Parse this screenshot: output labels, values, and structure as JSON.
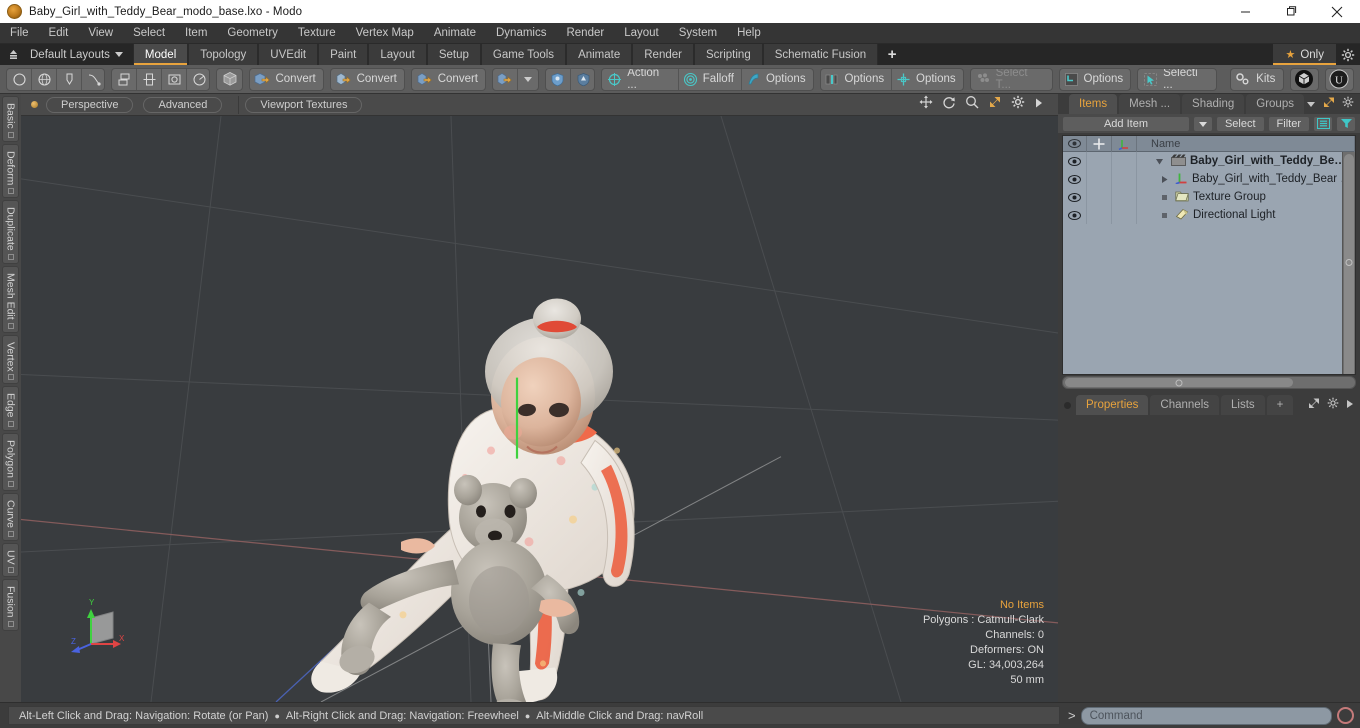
{
  "window": {
    "title": "Baby_Girl_with_Teddy_Bear_modo_base.lxo - Modo",
    "app_icon": "modo-app-icon",
    "minimize": "minimize-icon",
    "maximize": "restore-icon",
    "close": "close-icon"
  },
  "menubar": {
    "items": [
      "File",
      "Edit",
      "View",
      "Select",
      "Item",
      "Geometry",
      "Texture",
      "Vertex Map",
      "Animate",
      "Dynamics",
      "Render",
      "Layout",
      "System",
      "Help"
    ]
  },
  "layoutbar": {
    "home_icon": "home-layout-icon",
    "dropdown_label": "Default Layouts",
    "tabs": [
      "Model",
      "Topology",
      "UVEdit",
      "Paint",
      "Layout",
      "Setup",
      "Game Tools",
      "Animate",
      "Render",
      "Scripting",
      "Schematic Fusion"
    ],
    "active_tab": "Model",
    "add_tab": "+",
    "only_label": "Only",
    "only_star": "star-icon",
    "gear": "gear-icon"
  },
  "toolbar": {
    "groups": [
      {
        "items": [
          {
            "name": "circle-primitive-icon",
            "label": ""
          },
          {
            "name": "sphere-primitive-icon",
            "label": ""
          },
          {
            "name": "pen-tool-icon",
            "label": ""
          },
          {
            "name": "curve-tool-icon",
            "label": ""
          }
        ]
      },
      {
        "items": [
          {
            "name": "array-icon",
            "label": ""
          },
          {
            "name": "mirror-icon",
            "label": ""
          },
          {
            "name": "bevel-icon",
            "label": ""
          },
          {
            "name": "radial-icon",
            "label": ""
          }
        ]
      },
      {
        "items": [
          {
            "name": "cube-icon",
            "label": ""
          }
        ]
      },
      {
        "items": [
          {
            "name": "convert-mesh-icon",
            "label": "Convert"
          }
        ]
      },
      {
        "items": [
          {
            "name": "convert-curve-icon",
            "label": "Convert"
          }
        ]
      },
      {
        "items": [
          {
            "name": "convert-surface-icon",
            "label": "Convert"
          }
        ]
      },
      {
        "items": [
          {
            "name": "convert-extra-icon",
            "label": ""
          },
          {
            "name": "convert-dropdown-caret",
            "label": ""
          }
        ]
      },
      {
        "items": [
          {
            "name": "shield-blue-icon",
            "label": ""
          },
          {
            "name": "shield-dark-icon",
            "label": ""
          }
        ]
      },
      {
        "items": [
          {
            "name": "action-center-icon",
            "label": "Action  ..."
          },
          {
            "name": "falloff-icon",
            "label": "Falloff"
          },
          {
            "name": "symmetry-options-icon",
            "label": "Options"
          }
        ]
      },
      {
        "items": [
          {
            "name": "workplane-options-icon",
            "label": "Options"
          },
          {
            "name": "snapping-options-icon",
            "label": "Options"
          }
        ]
      },
      {
        "items": [
          {
            "name": "select-through-icon",
            "label": "Select T...",
            "dim": true
          }
        ]
      },
      {
        "items": [
          {
            "name": "grid-options-icon",
            "label": "Options"
          }
        ]
      },
      {
        "items": [
          {
            "name": "selection-set-icon",
            "label": "Selecti ..."
          }
        ]
      },
      {
        "items": [
          {
            "name": "kits-icon",
            "label": "Kits"
          }
        ]
      },
      {
        "items": [
          {
            "name": "modo-badge-icon",
            "label": ""
          }
        ]
      },
      {
        "items": [
          {
            "name": "unreal-badge-icon",
            "label": ""
          }
        ]
      }
    ]
  },
  "vtabs": {
    "items": [
      "Basic",
      "Deform",
      "Duplicate",
      "Mesh Edit",
      "Vertex",
      "Edge",
      "Polygon",
      "Curve",
      "UV",
      "Fusion"
    ]
  },
  "viewport_header": {
    "indicator": "active-viewport-dot",
    "pills": [
      "Perspective",
      "Advanced",
      "Viewport Textures"
    ],
    "icons": [
      "pan-icon",
      "rotate-icon",
      "zoom-icon",
      "fit-icon",
      "gear-icon",
      "expand-arrow-icon"
    ]
  },
  "viewport": {
    "stats": {
      "selection": "No Items",
      "polygons": "Polygons : Catmull-Clark",
      "channels": "Channels: 0",
      "deformers": "Deformers: ON",
      "gl": "GL: 34,003,264",
      "scale": "50 mm"
    },
    "axis_labels": {
      "y": "Y",
      "x": "X",
      "z": "Z"
    },
    "background_color": "#393c3f",
    "axis_colors": {
      "x": "#b05a5a",
      "y": "#3fa63f",
      "z": "#4a63c8"
    },
    "scene_description": "3D model of a baby girl holding a teddy bear"
  },
  "right_panel": {
    "tabs": [
      "Items",
      "Mesh ...",
      "Shading",
      "Groups"
    ],
    "active_tab": "Items",
    "tab_icons": [
      "caret-down-icon",
      "expand-icon",
      "gear-icon",
      "arrow-right-icon"
    ],
    "controls": {
      "add_item": "Add Item",
      "add_item_caret": "caret-down-icon",
      "select": "Select",
      "filter": "Filter",
      "list_icon": "list-view-icon",
      "funnel_icon": "funnel-icon"
    },
    "columns": {
      "eye": "eye-icon",
      "lock": "crosshair-icon",
      "xform": "axis-icon",
      "name": "Name"
    },
    "rows": [
      {
        "icon": "scene-clapper-icon",
        "label": "Baby_Girl_with_Teddy_Be…",
        "bold": true,
        "expanded": true,
        "indent": 0
      },
      {
        "icon": "mesh-axis-icon",
        "label": "Baby_Girl_with_Teddy_Bear …",
        "bold": false,
        "expanded": false,
        "indent": 1
      },
      {
        "icon": "texture-group-icon",
        "label": "Texture Group",
        "bold": false,
        "expanded": null,
        "indent": 1
      },
      {
        "icon": "directional-light-icon",
        "label": "Directional Light",
        "bold": false,
        "expanded": null,
        "indent": 1
      }
    ],
    "bottom_tabs": [
      "Properties",
      "Channels",
      "Lists"
    ],
    "bottom_active": "Properties",
    "bottom_add": "+",
    "bottom_icons": [
      "expand-icon",
      "gear-icon",
      "arrow-right-icon"
    ]
  },
  "statusbar": {
    "hints": [
      "Alt-Left Click and Drag: Navigation: Rotate (or Pan)",
      "Alt-Right Click and Drag: Navigation: Freewheel",
      "Alt-Middle Click and Drag: navRoll"
    ],
    "separator": "●",
    "command_prompt": ">",
    "command_placeholder": "Command",
    "command_value": "",
    "record_icon": "record-circle-icon"
  },
  "colors": {
    "accent": "#e8a33d",
    "panel_bg": "#3c3c3c",
    "toolbar_bg": "#5c5c5c",
    "list_bg": "#9aa5b1",
    "viewport_bg": "#393c3f"
  }
}
